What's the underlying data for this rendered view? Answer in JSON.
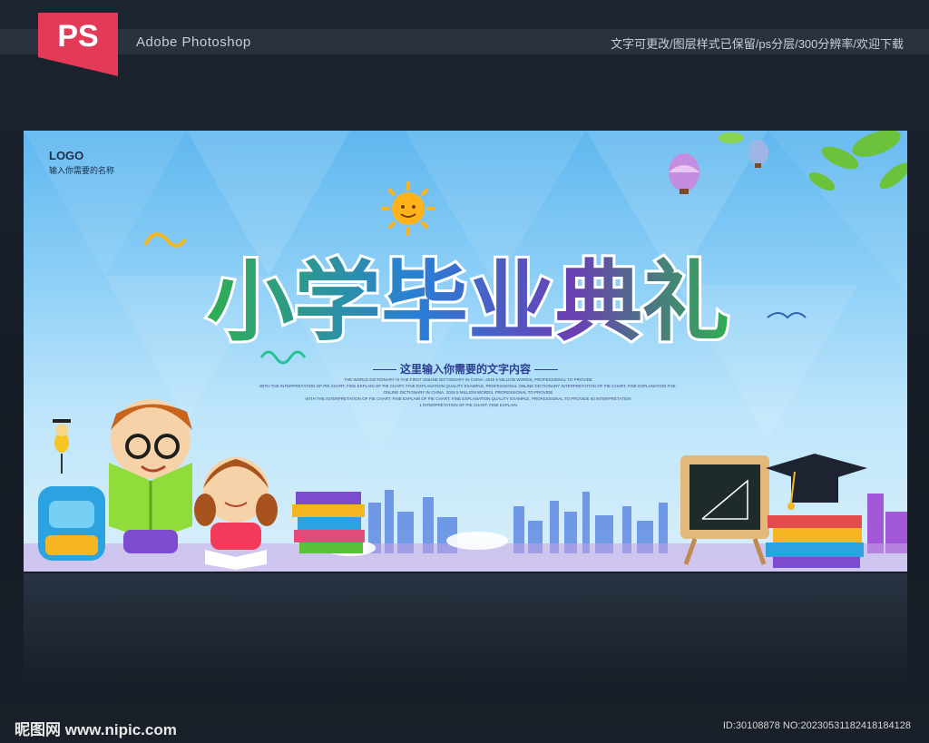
{
  "header": {
    "badge": "PS",
    "app_name": "Adobe Photoshop",
    "features": "文字可更改/图层样式已保留/ps分层/300分辨率/欢迎下载"
  },
  "poster": {
    "logo": "LOGO",
    "logo_sub": "输入你需要的名称",
    "title": "小学毕业典礼",
    "subtitle": "这里输入你需要的文字内容",
    "fine_lines": [
      "THE WORLD DICTIONARY IS THE FIRST ONLINE DICTIONARY IN CHINA. 2015 5 MILLION WORDS, PROFESSIONAL TO PROVIDE",
      "WITH THE INTERPRETATION OF PIE CHART, FINE EXPLAIN OF PIE CHART, FINE EXPLANATION QUALITY EXAMPLE, PROFESSIONAL ONLINE DICTIONARY INTERPRETATION OF PIE CHART, FINE EXPLANATION THE WOT",
      "ONLINE DICTIONARY IN CHINA. 2015 5 MILLION WORDS, PROFESSIONAL TO PROVIDE",
      "WITH THE INTERPRETATION OF PIE CHART, FINE EXPLAIN OF PIE CHART, FINE EXPLANATION QUALITY EXAMPLE, PROFESSIONAL TO PROVIDE 60 INTERPRETATION",
      "1 INTERPRETATION OF PIE CHART, FINE EXPLAIN"
    ]
  },
  "footer": {
    "watermark": "昵图网 www.nipic.com",
    "image_id": "ID:30108878 NO:20230531182418184128"
  },
  "colors": {
    "accent": "#e23a57",
    "title_green": "#2fae52",
    "title_purple": "#6a3fb3",
    "title_blue": "#2a7fd6"
  }
}
